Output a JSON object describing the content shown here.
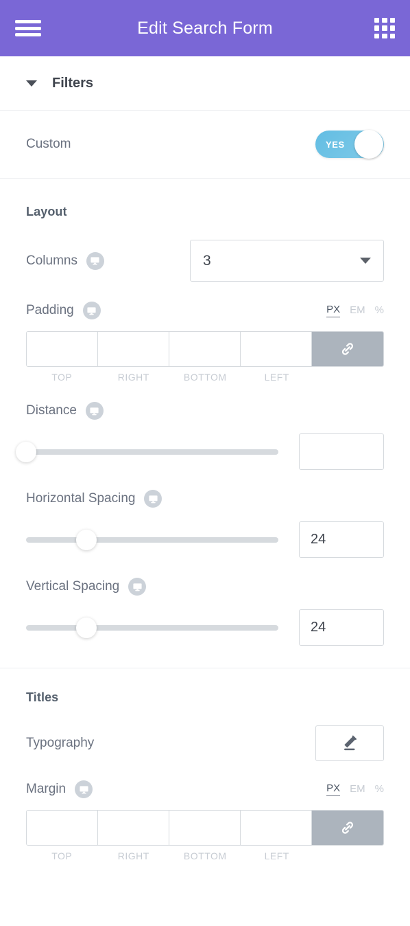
{
  "header": {
    "title": "Edit Search Form",
    "menu_icon": "hamburger-menu-icon",
    "grid_icon": "apps-grid-icon",
    "accent_color": "#7a67d6"
  },
  "section": {
    "title": "Filters",
    "collapse_icon": "chevron-down-icon"
  },
  "custom": {
    "label": "Custom",
    "toggle_value": "YES",
    "toggle_color": "#6ec1e4"
  },
  "layout": {
    "title": "Layout",
    "columns": {
      "label": "Columns",
      "value": "3",
      "responsive_icon": "desktop-icon"
    },
    "padding": {
      "label": "Padding",
      "responsive_icon": "desktop-icon",
      "units": [
        "PX",
        "EM",
        "%"
      ],
      "active_unit": "PX",
      "values": [
        "",
        "",
        "",
        ""
      ],
      "sides": [
        "TOP",
        "RIGHT",
        "BOTTOM",
        "LEFT"
      ],
      "link_icon": "chain-link-icon"
    },
    "distance": {
      "label": "Distance",
      "responsive_icon": "desktop-icon",
      "value": "",
      "slider_percent": 0
    },
    "horizontal_spacing": {
      "label": "Horizontal Spacing",
      "responsive_icon": "desktop-icon",
      "value": "24",
      "slider_percent": 24
    },
    "vertical_spacing": {
      "label": "Vertical Spacing",
      "responsive_icon": "desktop-icon",
      "value": "24",
      "slider_percent": 24
    }
  },
  "titles": {
    "title": "Titles",
    "typography": {
      "label": "Typography",
      "edit_icon": "pencil-edit-icon"
    },
    "margin": {
      "label": "Margin",
      "responsive_icon": "desktop-icon",
      "units": [
        "PX",
        "EM",
        "%"
      ],
      "active_unit": "PX",
      "values": [
        "",
        "",
        "",
        ""
      ],
      "sides": [
        "TOP",
        "RIGHT",
        "BOTTOM",
        "LEFT"
      ],
      "link_icon": "chain-link-icon"
    }
  }
}
